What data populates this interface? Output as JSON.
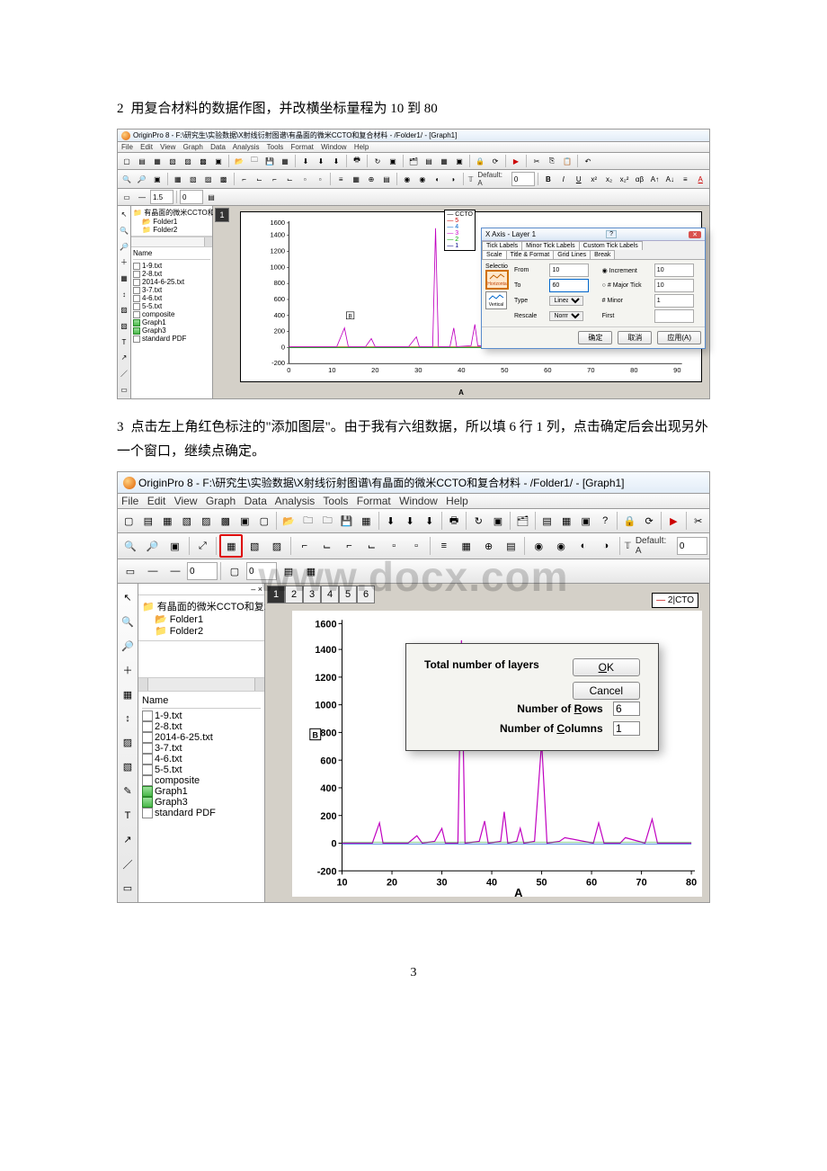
{
  "step2": {
    "num": "2",
    "text": "用复合材料的数据作图，并改横坐标量程为 10 到 80"
  },
  "step3": {
    "num": "3",
    "text": "点击左上角红色标注的\"添加图层\"。由于我有六组数据，所以填 6 行 1 列，点击确定后会出现另外一个窗口，继续点确定。"
  },
  "fig1": {
    "title": "OriginPro 8 - F:\\研究生\\实验数据\\X射线衍射图谱\\有晶面的微米CCTO和复合材料 - /Folder1/ - [Graph1]",
    "menu": [
      "File",
      "Edit",
      "View",
      "Graph",
      "Data",
      "Analysis",
      "Tools",
      "Format",
      "Window",
      "Help"
    ],
    "tb_default": "Default: A",
    "tree_root": "有晶面的微米CCTO和复:",
    "tree_f1": "Folder1",
    "tree_f2": "Folder2",
    "file_hdr": "Name",
    "files": [
      "1-9.txt",
      "2-8.txt",
      "2014-6-25.txt",
      "3-7.txt",
      "4-6.txt",
      "5-5.txt",
      "composite",
      "Graph1",
      "Graph3",
      "standard PDF"
    ],
    "legend": [
      "CCTO",
      "5",
      "4",
      "3",
      "2",
      "1"
    ],
    "xaxis_label": "A",
    "dialog": {
      "title": "X Axis - Layer 1",
      "tabs": [
        "Tick Labels",
        "Minor Tick Labels",
        "Custom Tick Labels",
        "Scale",
        "Title & Format",
        "Grid Lines",
        "Break"
      ],
      "selection_label": "Selectio",
      "sel_h": "Horizonta",
      "sel_v": "Vertical",
      "from_label": "From",
      "from_value": "10",
      "to_label": "To",
      "to_value": "60",
      "type_label": "Type",
      "type_value": "Linear",
      "rescale_label": "Rescale",
      "rescale_value": "Normal",
      "incr_label": "Increment",
      "incr_value": "10",
      "major_label": "# Major Tick",
      "major_value": "10",
      "minor_label": "# Minor",
      "minor_value": "1",
      "first_label": "First",
      "btn_ok": "确定",
      "btn_cancel": "取消",
      "btn_apply": "应用(A)"
    }
  },
  "fig2": {
    "title": "OriginPro 8 - F:\\研究生\\实验数据\\X射线衍射图谱\\有晶面的微米CCTO和复合材料 - /Folder1/ - [Graph1]",
    "menu": [
      "File",
      "Edit",
      "View",
      "Graph",
      "Data",
      "Analysis",
      "Tools",
      "Format",
      "Window",
      "Help"
    ],
    "tb_default": "Default: A",
    "tree_root": "有晶面的微米CCTO和复1",
    "tree_f1": "Folder1",
    "tree_f2": "Folder2",
    "file_hdr": "Name",
    "files": [
      "1-9.txt",
      "2-8.txt",
      "2014-6-25.txt",
      "3-7.txt",
      "4-6.txt",
      "5-5.txt",
      "composite",
      "Graph1",
      "Graph3",
      "standard PDF"
    ],
    "layer_tabs": [
      "1",
      "2",
      "3",
      "4",
      "5",
      "6"
    ],
    "legend": "2|CTO",
    "xaxis_label": "A",
    "dialog": {
      "title": "Total number of layers",
      "rows_label": "Number of Rows",
      "rows_value": "6",
      "cols_label": "Number of Columns",
      "cols_value": "1",
      "btn_ok": "OK",
      "btn_cancel": "Cancel"
    }
  },
  "chart_data": [
    {
      "type": "line",
      "title": "",
      "xlabel": "A",
      "ylabel": "",
      "xlim": [
        0,
        90
      ],
      "ylim": [
        -200,
        1600
      ],
      "xticks": [
        0,
        10,
        20,
        30,
        40,
        50,
        60,
        70,
        80,
        90
      ],
      "yticks": [
        -200,
        0,
        200,
        400,
        600,
        800,
        1000,
        1200,
        1400,
        1600
      ],
      "series": [
        {
          "name": "CCTO",
          "color": "#000000"
        },
        {
          "name": "5",
          "color": "#d02020"
        },
        {
          "name": "4",
          "color": "#1060d0"
        },
        {
          "name": "3",
          "color": "#d000d0"
        },
        {
          "name": "2",
          "color": "#10a010"
        },
        {
          "name": "1",
          "color": "#000080"
        }
      ],
      "peaks_x": [
        12,
        18,
        29,
        33,
        34,
        38,
        42,
        44,
        46,
        49,
        53,
        56,
        61,
        63,
        72,
        78
      ],
      "baseline_y": 0,
      "main_peak": {
        "x": 34,
        "y": 1500
      }
    },
    {
      "type": "line",
      "title": "",
      "xlabel": "A",
      "ylabel": "",
      "xlim": [
        10,
        80
      ],
      "ylim": [
        -200,
        1600
      ],
      "xticks": [
        10,
        20,
        30,
        40,
        50,
        60,
        70,
        80
      ],
      "yticks": [
        -200,
        0,
        200,
        400,
        600,
        800,
        1000,
        1200,
        1400,
        1600
      ],
      "series": [
        {
          "name": "2CTO",
          "color": "#d000d0"
        }
      ],
      "peaks_x": [
        18,
        25,
        29,
        33,
        34,
        38,
        42,
        44,
        46,
        49,
        53,
        56,
        61,
        63,
        67,
        72,
        78
      ],
      "baseline_y": 0,
      "main_peak": {
        "x": 34,
        "y": 1450
      }
    }
  ],
  "watermark": "www.docx.com",
  "page_number": "3"
}
